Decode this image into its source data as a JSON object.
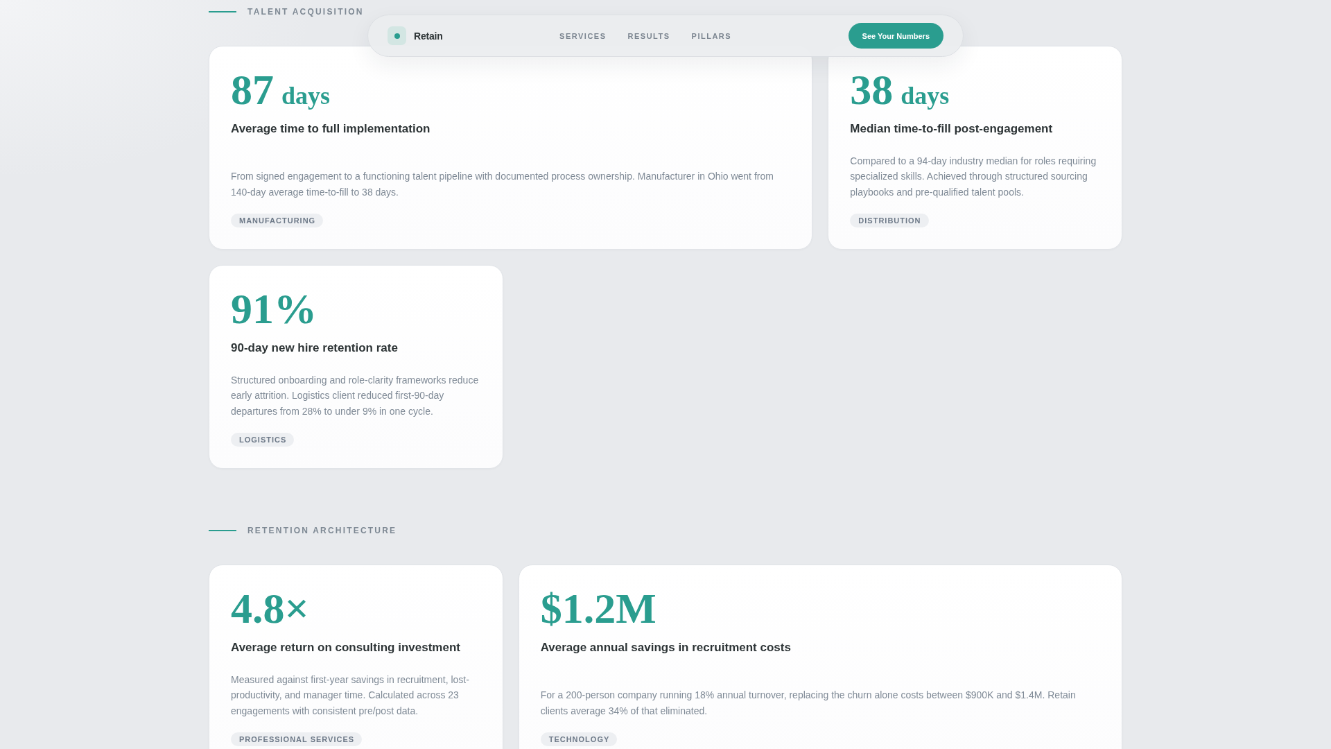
{
  "nav": {
    "brand": "Retain",
    "links": [
      "SERVICES",
      "RESULTS",
      "PILLARS"
    ],
    "cta": "See Your Numbers"
  },
  "sections": [
    {
      "label": "TALENT ACQUISITION",
      "cards": [
        {
          "value": "87",
          "unit": "days",
          "title": "Average time to full implementation",
          "description": "From signed engagement to a functioning talent pipeline with documented process ownership. Manufacturer in Ohio went from 140-day average time-to-fill to 38 days.",
          "tag": "MANUFACTURING"
        },
        {
          "value": "38",
          "unit": "days",
          "title": "Median time-to-fill post-engagement",
          "description": "Compared to a 94-day industry median for roles requiring specialized skills. Achieved through structured sourcing playbooks and pre-qualified talent pools.",
          "tag": "DISTRIBUTION"
        },
        {
          "value": "91%",
          "title": "90-day new hire retention rate",
          "description": "Structured onboarding and role-clarity frameworks reduce early attrition. Logistics client reduced first-90-day departures from 28% to under 9% in one cycle.",
          "tag": "LOGISTICS"
        }
      ]
    },
    {
      "label": "RETENTION ARCHITECTURE",
      "cards": [
        {
          "value": "4.8×",
          "title": "Average return on consulting investment",
          "description": "Measured against first-year savings in recruitment, lost-productivity, and manager time. Calculated across 23 engagements with consistent pre/post data.",
          "tag": "PROFESSIONAL SERVICES"
        },
        {
          "value": "$1.2M",
          "title": "Average annual savings in recruitment costs",
          "description": "For a 200-person company running 18% annual turnover, replacing the churn alone costs between $900K and $1.4M. Retain clients average 34% of that eliminated.",
          "tag": "TECHNOLOGY"
        }
      ]
    }
  ]
}
